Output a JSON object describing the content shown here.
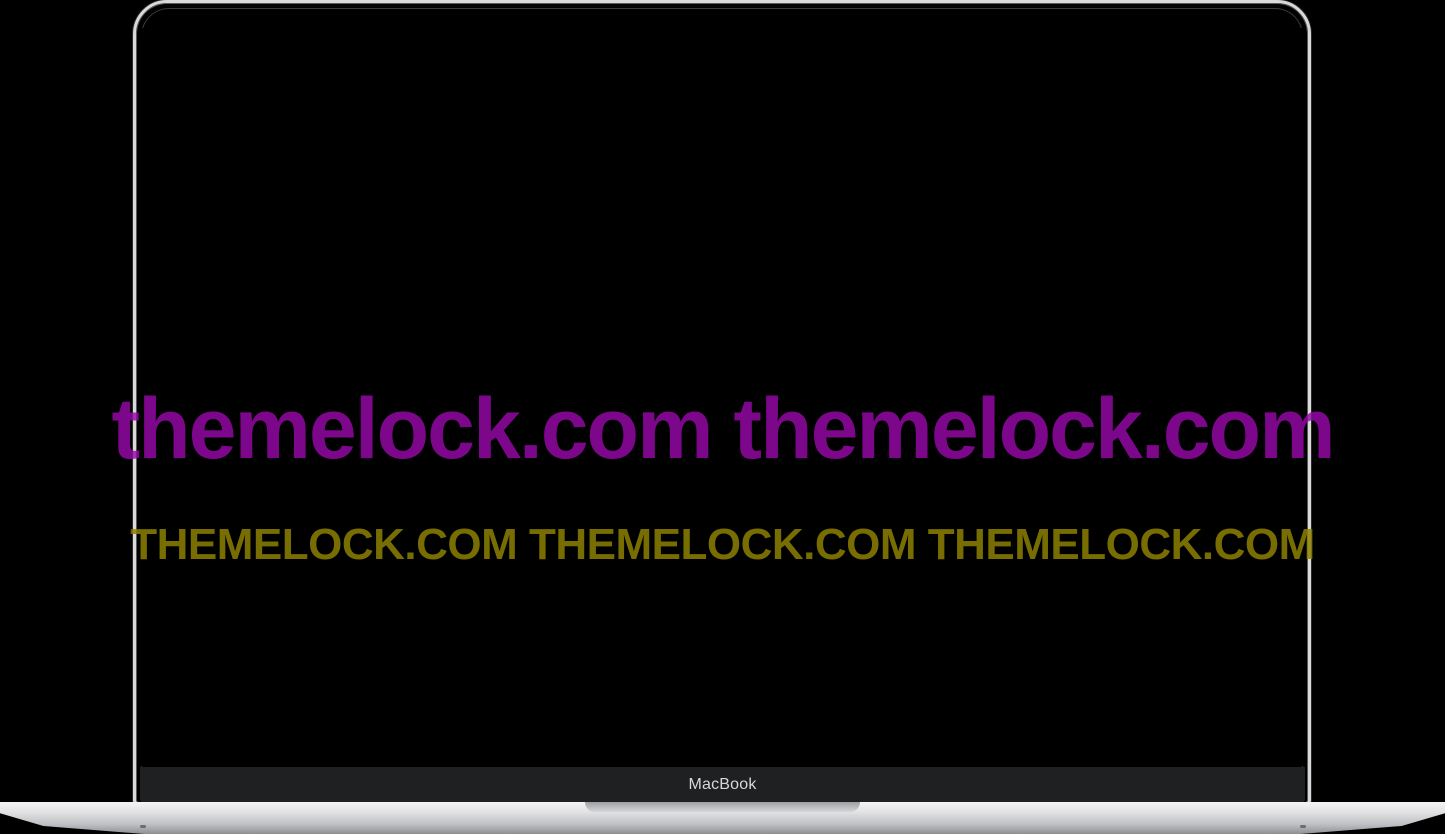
{
  "device": {
    "chin_label": "MacBook"
  },
  "watermark": {
    "line1": "themelock.com themelock.com",
    "line2": "THEMELOCK.COM THEMELOCK.COM THEMELOCK.COM",
    "line1_color": "#9808aa",
    "line2_color": "#8c8000"
  },
  "screen": {
    "background": "#000000"
  }
}
